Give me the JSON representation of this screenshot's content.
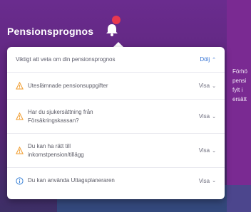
{
  "colors": {
    "accent": "#6a2c8e",
    "warning": "#f2a23a",
    "info": "#3b82d6",
    "link": "#2f6fd3",
    "badge": "#e8384f"
  },
  "header": {
    "title": "Pensionsprognos"
  },
  "side_text": [
    "Förhö",
    "pensi",
    "fylt i",
    "ersätt"
  ],
  "popup": {
    "intro": "Viktigt att veta om din pensionsprognos",
    "toggle_label": "Dölj",
    "items": [
      {
        "icon": "warning-icon",
        "text_lines": [
          "Uteslämnade pensionsuppgifter"
        ],
        "action": "Visa"
      },
      {
        "icon": "warning-icon",
        "text_lines": [
          "Har du sjukersättning från",
          "Försäkringskassan?"
        ],
        "action": "Visa"
      },
      {
        "icon": "warning-icon",
        "text_lines": [
          "Du kan ha rätt till",
          "inkomstpension/tillägg"
        ],
        "action": "Visa"
      },
      {
        "icon": "info-icon",
        "text_lines": [
          "Du kan använda Uttagsplaneraren"
        ],
        "action": "Visa"
      }
    ]
  }
}
